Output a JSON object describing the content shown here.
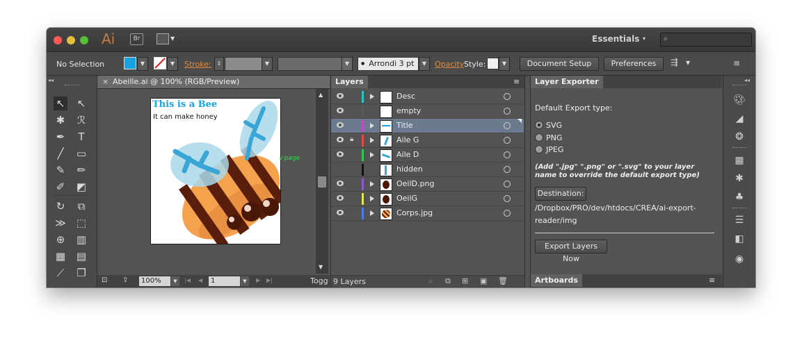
{
  "app": {
    "logo": "Ai",
    "bridge": "Br",
    "workspace": "Essentials"
  },
  "control": {
    "selection": "No Selection",
    "stroke_label": "Stroke:",
    "brush": "Arrondi 3 pt",
    "opacity_label": "Opacity",
    "style_label": "Style:",
    "document_setup": "Document Setup",
    "preferences": "Preferences",
    "fill_color": "#1aa3e3"
  },
  "document": {
    "tab_title": "Abeille.ai @ 100% (RGB/Preview)",
    "artboard_title": "This is a Bee",
    "artboard_subtitle": "It can make honey",
    "page_label": "page",
    "zoom": "100%",
    "page_number": "1",
    "toggle": "Togg"
  },
  "layers_panel": {
    "title": "Layers",
    "count": "9 Layers",
    "layers": [
      {
        "name": "Desc",
        "color": "#2bc3c3",
        "locked": false,
        "visible": true
      },
      {
        "name": "empty",
        "color": "#5b5b5b",
        "locked": false,
        "visible": true
      },
      {
        "name": "Title",
        "color": "#c34bc3",
        "locked": false,
        "visible": true
      },
      {
        "name": "Aile G",
        "color": "#e34b4b",
        "locked": true,
        "visible": true
      },
      {
        "name": "Aile D",
        "color": "#3ac35b",
        "locked": false,
        "visible": true
      },
      {
        "name": "hidden",
        "color": "#111111",
        "locked": false,
        "visible": false
      },
      {
        "name": "OeilD.png",
        "color": "#8b5bd3",
        "locked": false,
        "visible": true
      },
      {
        "name": "OeilG",
        "color": "#e3e35b",
        "locked": false,
        "visible": true
      },
      {
        "name": "Corps.jpg",
        "color": "#4b7be3",
        "locked": false,
        "visible": true
      }
    ]
  },
  "exporter": {
    "title": "Layer Exporter",
    "default_label": "Default Export type:",
    "options": [
      "SVG",
      "PNG",
      "JPEG"
    ],
    "selected": "SVG",
    "hint": "(Add \".jpg\" \".png\" or \".svg\" to your layer name to override the default export type)",
    "destination_button": "Destination:",
    "destination_path_1": "/Dropbox/PRO/dev/htdocs/CREA/ai-export-",
    "destination_path_2": "reader/img",
    "export_button": "Export Layers Now",
    "artboards_tab": "Artboards"
  }
}
